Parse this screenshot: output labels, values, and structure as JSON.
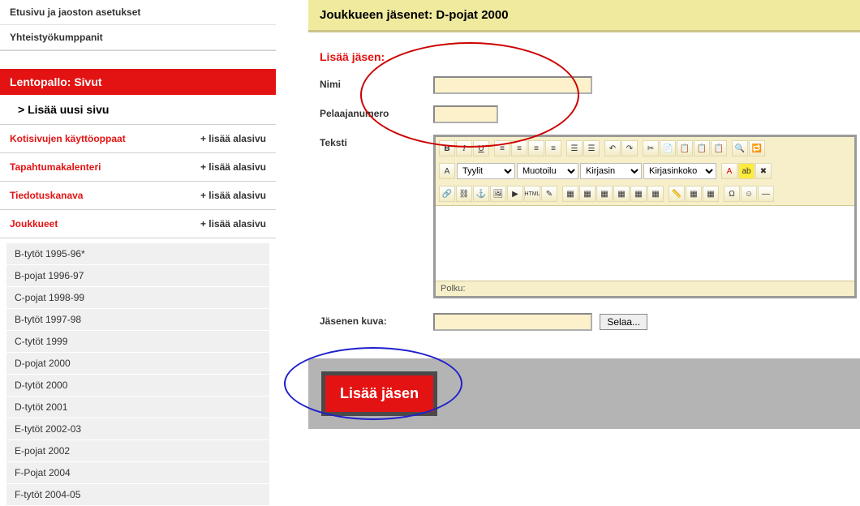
{
  "sidebar": {
    "top": [
      "Etusivu ja jaoston asetukset",
      "Yhteistyökumppanit"
    ],
    "header": "Lentopallo: Sivut",
    "add_page": "> Lisää uusi sivu",
    "rows": [
      {
        "label": "Kotisivujen käyttöoppaat",
        "action": "+ lisää alasivu"
      },
      {
        "label": "Tapahtumakalenteri",
        "action": "+ lisää alasivu"
      },
      {
        "label": "Tiedotuskanava",
        "action": "+ lisää alasivu"
      },
      {
        "label": "Joukkueet",
        "action": "+ lisää alasivu"
      }
    ],
    "teams": [
      "B-tytöt 1995-96*",
      "B-pojat 1996-97",
      "C-pojat 1998-99",
      "B-tytöt 1997-98",
      "C-tytöt 1999",
      "D-pojat 2000",
      "D-tytöt 2000",
      "D-tytöt 2001",
      "E-tytöt 2002-03",
      "E-pojat 2002",
      "F-Pojat 2004",
      "F-tytöt 2004-05"
    ]
  },
  "page": {
    "title": "Joukkueen jäsenet: D-pojat 2000",
    "section_title": "Lisää jäsen:",
    "labels": {
      "name": "Nimi",
      "number": "Pelajanumero",
      "text": "Teksti",
      "image": "Jäsenen kuva:"
    },
    "number_label_actual": "Pelaajanumero",
    "buttons": {
      "browse": "Selaa...",
      "submit": "Lisää jäsen"
    },
    "editor": {
      "style": "Tyylit",
      "format": "Muotoilu",
      "font": "Kirjasin",
      "fontsize": "Kirjasinkoko",
      "path_label": "Polku:"
    }
  }
}
